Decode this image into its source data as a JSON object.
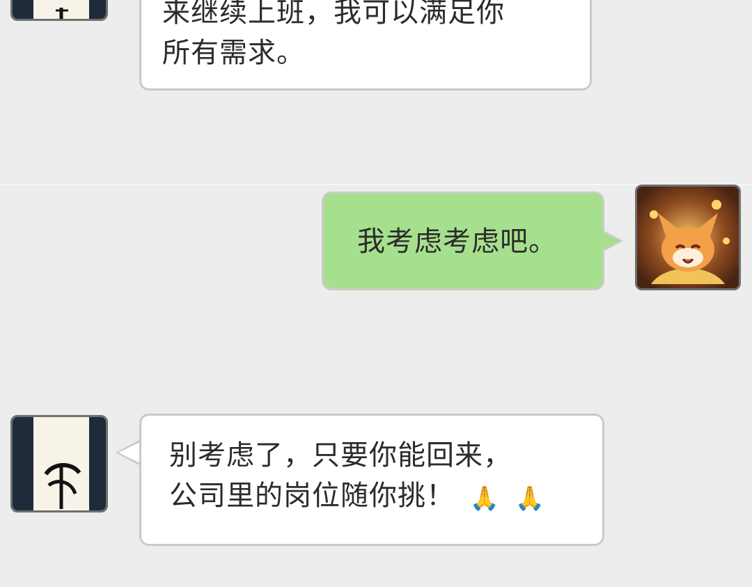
{
  "messages": [
    {
      "side": "left",
      "lines": [
        "来继续上班，我可以满足你",
        "所有需求。"
      ]
    },
    {
      "side": "right",
      "text": "我考虑考虑吧。"
    },
    {
      "side": "left",
      "lines": [
        "别考虑了，只要你能回来，",
        "公司里的岗位随你挑！"
      ],
      "emoji": [
        "🙏",
        "🙏"
      ]
    }
  ],
  "avatars": {
    "left": {
      "name": "calligraphy-avatar",
      "accent": "#1f2b3b"
    },
    "right": {
      "name": "fox-avatar",
      "accent": "#e29a45"
    }
  },
  "colors": {
    "background": "#ededed",
    "bubble_left": "#ffffff",
    "bubble_right": "#a6e08f",
    "text": "#2b2b2b"
  }
}
